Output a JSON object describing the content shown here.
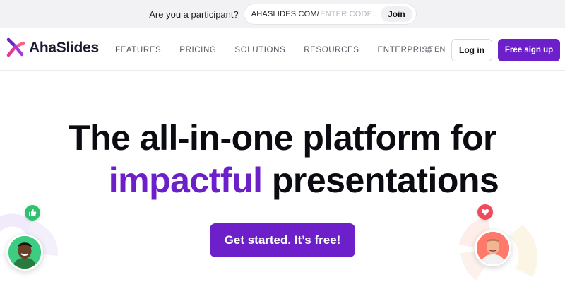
{
  "participant_bar": {
    "question": "Are you a participant?",
    "url_prefix": "AHASLIDES.COM/",
    "code_placeholder": "ENTER CODE...",
    "join_label": "Join"
  },
  "header": {
    "brand": "AhaSlides",
    "nav_links": [
      "FEATURES",
      "PRICING",
      "SOLUTIONS",
      "RESOURCES",
      "ENTERPRISE"
    ],
    "language": "EN",
    "login_label": "Log in",
    "signup_label": "Free sign up"
  },
  "hero": {
    "line1": "The all-in-one platform for",
    "line2_accent": "impactful",
    "line2_rest": "presentations",
    "cta_label": "Get started. It’s free!"
  },
  "colors": {
    "brand_purple": "#6d1fc9",
    "topbar_bg": "#f2f2f4",
    "like_green": "#2fc16f",
    "heart_red": "#f04a5f"
  },
  "icons": {
    "logo": "ahaslides-logo-icon",
    "language": "globe-icon",
    "like_badge": "thumbs-up-icon",
    "heart_badge": "heart-icon"
  }
}
